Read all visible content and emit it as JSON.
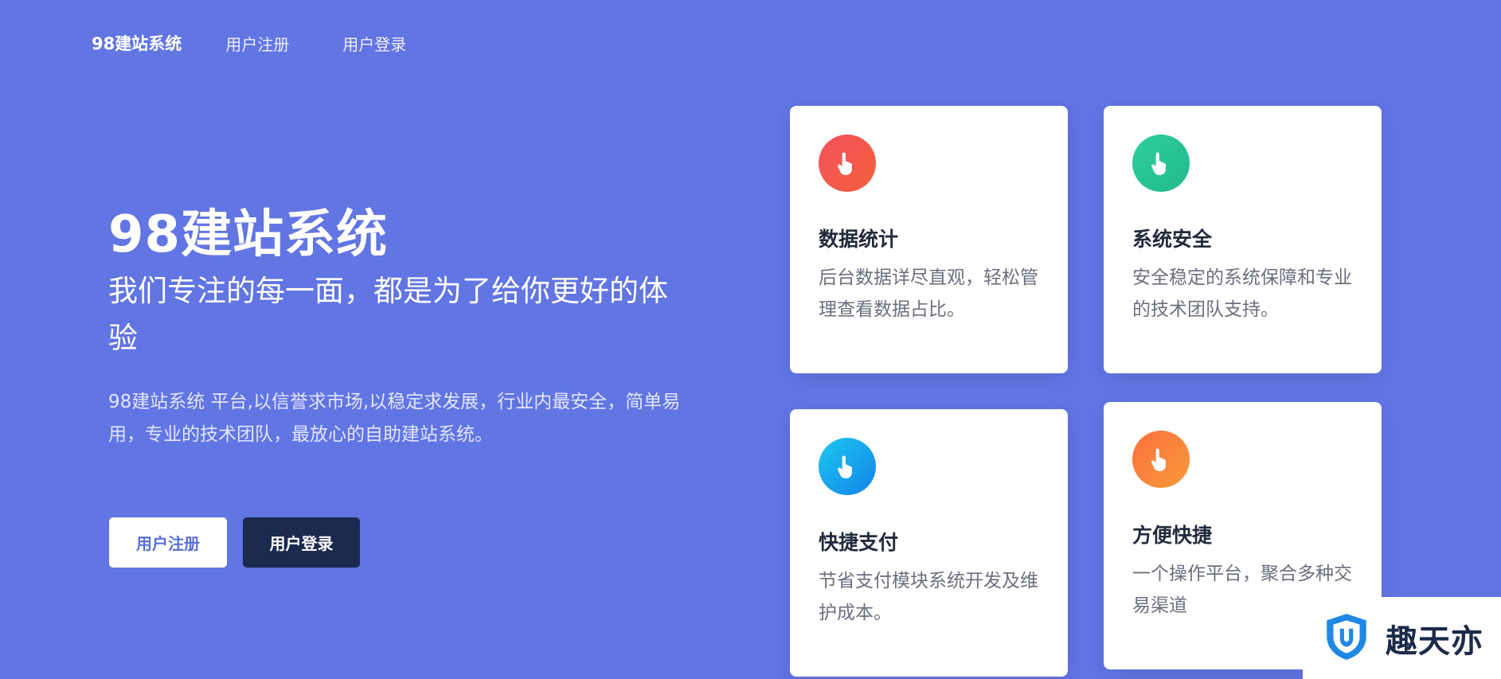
{
  "nav": {
    "brand": "98建站系统",
    "register": "用户注册",
    "login": "用户登录"
  },
  "hero": {
    "title": "98建站系统",
    "subtitle": "我们专注的每一面，都是为了给你更好的体验",
    "description": "98建站系统 平台,以信誉求市场,以稳定求发展，行业内最安全，简单易用，专业的技术团队，最放心的自助建站系统。",
    "register_button": "用户注册",
    "login_button": "用户登录"
  },
  "cards": [
    {
      "title": "数据统计",
      "text": "后台数据详尽直观，轻松管理查看数据占比。",
      "icon": "pointer-hand-icon",
      "color": "#f3544f"
    },
    {
      "title": "系统安全",
      "text": "安全稳定的系统保障和专业的技术团队支持。",
      "icon": "pointer-hand-icon",
      "color": "#27c497"
    },
    {
      "title": "快捷支付",
      "text": "节省支付模块系统开发及维护成本。",
      "icon": "pointer-hand-icon",
      "color": "#1aa6ee"
    },
    {
      "title": "方便快捷",
      "text": "一个操作平台，聚合多种交易渠道",
      "icon": "pointer-hand-icon",
      "color": "#f9803b"
    }
  ],
  "watermark": {
    "text": "趣天亦",
    "icon": "shield-logo-icon",
    "color": "#1e88e5"
  },
  "colors": {
    "background": "#6175e3",
    "dark_button": "#1b2a4e",
    "card_title": "#222a3c"
  }
}
